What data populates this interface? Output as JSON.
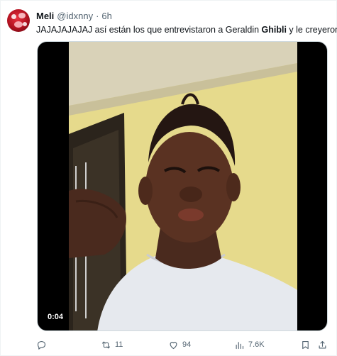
{
  "tweet": {
    "author": {
      "name": "Meli",
      "handle": "@idxnny",
      "separator": "·",
      "time": "6h"
    },
    "text_before": "JAJAJAJAJAJ así están los que entrevistaron a Geraldin ",
    "text_bold": "Ghibli",
    "text_after": " y le creyeron",
    "media": {
      "type": "video",
      "timestamp": "0:04"
    },
    "actions": {
      "reply_icon": "reply-icon",
      "retweet_icon": "retweet-icon",
      "retweet_count": "11",
      "like_icon": "heart-icon",
      "like_count": "94",
      "views_icon": "views-icon",
      "views_count": "7.6K",
      "bookmark_icon": "bookmark-icon",
      "share_icon": "share-icon"
    },
    "colors": {
      "text": "#0f1419",
      "secondary": "#536471",
      "avatar": "#c8102e"
    }
  }
}
